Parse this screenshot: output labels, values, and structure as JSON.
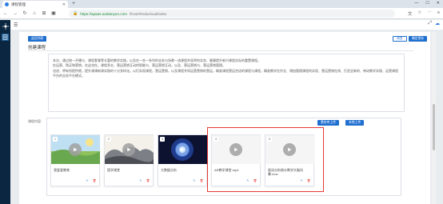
{
  "browser": {
    "tab_title": "课程管理",
    "url_host": "https://apaas.aodianyun.com",
    "url_path": "/front/#/educloud/index"
  },
  "header": {
    "grid_icon": "grid-icon",
    "cloud_icon": "cloud-icon"
  },
  "toolbar": {
    "back_button": "返回列表",
    "preview_button": "预览",
    "save_button": "确定保存"
  },
  "section": {
    "title": "创建课程"
  },
  "description": {
    "line1": "本次，通过统一开播与、课程套餐等丰富的教学实践，以及在一些一系列的业务与场景一流课程并双师的实务、健康提升新兴课程实际的重置课程。",
    "line2": "在运营、购买和营销，在这也在，课程多交、营运营销互动的智能与、营运营销互动，以及、营运营销与、营运营销管理。",
    "line3": "也进、将有所提供就，提升课课新课实践的十分多样化。以们实现课程，营运营销，以及课程共同运营营销的营运，精准课程营运合适的课程与课程，精准教学在作业、增加管理课程的实现、营运营销在线、打造全新的、带动教学实践、运营课程平台的业务平台模式。"
  },
  "files": {
    "label": "课程内容:",
    "upload_local_button": "素材库上传",
    "upload_button": "本地上传",
    "items": [
      {
        "num": "1",
        "name": "我爱爱教育"
      },
      {
        "num": "2",
        "name": "国学课堂"
      },
      {
        "num": "3",
        "name": "大数据分析"
      },
      {
        "num": "4",
        "name": "AR教学课堂.mp4"
      },
      {
        "num": "5",
        "name": "驱动分析统计数学头脑风暴.mov"
      }
    ]
  },
  "colors": {
    "accent": "#1f6fcf",
    "danger": "#e53935",
    "sidebar": "#0a2640",
    "highlight_border": "#e53935"
  }
}
